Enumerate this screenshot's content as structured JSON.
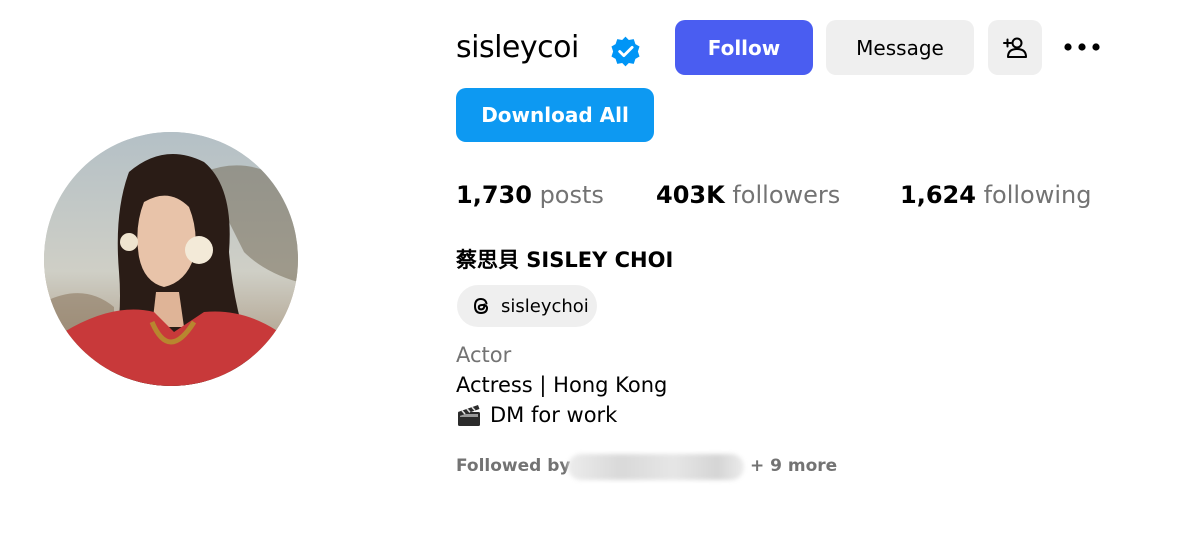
{
  "profile": {
    "username": "sisleycoi",
    "verified": true,
    "full_name": "蔡思貝 SISLEY CHOI",
    "threads_handle": "sisleychoi",
    "category": "Actor",
    "bio_line1": "Actress | Hong Kong",
    "bio_line2": "DM for work",
    "avatar_icon": "profile-photo"
  },
  "actions": {
    "follow_label": "Follow",
    "message_label": "Message",
    "download_all_label": "Download All",
    "add_user_icon": "add-user-icon",
    "more_icon": "more-options-icon"
  },
  "stats": {
    "posts_count": "1,730",
    "posts_label": "posts",
    "followers_count": "403K",
    "followers_label": "followers",
    "following_count": "1,624",
    "following_label": "following"
  },
  "followed_by": {
    "prefix": "Followed by",
    "more": "+ 9 more"
  },
  "colors": {
    "follow_button": "#4a5df1",
    "download_button": "#0d99f2",
    "secondary_button": "#efefef",
    "verified_badge": "#0095f6",
    "muted_text": "#737373"
  }
}
